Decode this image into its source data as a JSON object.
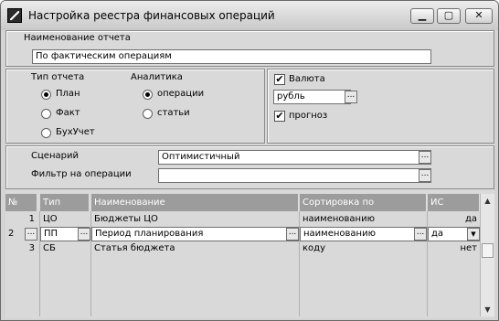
{
  "window": {
    "title": "Настройка реестра финансовых операций",
    "buttons": {
      "minimize": "▁",
      "maximize": "▢",
      "close": "✕"
    }
  },
  "report_name": {
    "label": "Наименование отчета",
    "value": "По фактическим операциям"
  },
  "report_type": {
    "label": "Тип отчета",
    "options": [
      "План",
      "Факт",
      "БухУчет"
    ],
    "selected": "План"
  },
  "analytics": {
    "label": "Аналитика",
    "options": [
      "операции",
      "статьи"
    ],
    "selected": "операции"
  },
  "currency": {
    "checkbox_label": "Валюта",
    "checked": true,
    "value": "рубль",
    "forecast_label": "прогноз",
    "forecast_checked": true
  },
  "scenario": {
    "label": "Сценарий",
    "value": "Оптимистичный"
  },
  "operation_filter": {
    "label": "Фильтр на операции",
    "value": ""
  },
  "ellipsis": "...",
  "grid": {
    "columns": [
      "№",
      "Тип",
      "Наименование",
      "Сортировка по",
      "ИС"
    ],
    "rows": [
      {
        "num": "1",
        "type": "ЦО",
        "name": "Бюджеты ЦО",
        "sort": "наименованию",
        "is": "да"
      },
      {
        "num": "2",
        "type": "ПП",
        "name": "Период планирования",
        "sort": "наименованию",
        "is": "да"
      },
      {
        "num": "3",
        "type": "СБ",
        "name": "Статья бюджета",
        "sort": "коду",
        "is": "нет"
      }
    ]
  },
  "icons": {
    "app": "app-icon",
    "check": "✔",
    "scroll_up": "▲",
    "scroll_down": "▼",
    "dropdown": "▼"
  },
  "colors": {
    "grid_header": "#9c9c9c",
    "window_bg": "#d9d9d9",
    "field_bg": "#ffffff"
  }
}
